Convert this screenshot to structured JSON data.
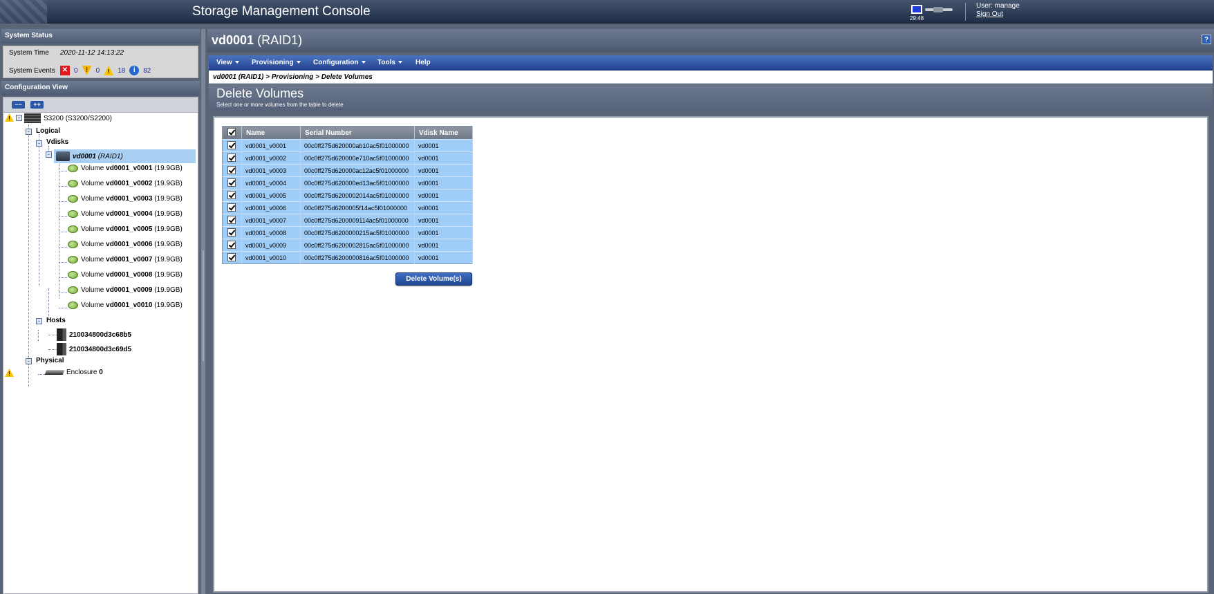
{
  "header": {
    "title": "Storage Management Console",
    "clock": "29:48",
    "user_label": "User: manage",
    "sign_out": "Sign Out"
  },
  "system_status": {
    "heading": "System Status",
    "time_label": "System Time",
    "time_value": "2020-11-12 14:13:22",
    "events_label": "System Events",
    "events": {
      "error": "0",
      "critical": "0",
      "warning": "18",
      "info": "82"
    }
  },
  "config_view": {
    "heading": "Configuration View",
    "collapse_label": "−−",
    "expand_label": "++",
    "array": "S3200 (S3200/S2200)",
    "logical": "Logical",
    "vdisks": "Vdisks",
    "vdisk_name": "vd0001",
    "vdisk_type": "(RAID1)",
    "volumes": [
      {
        "prefix": "Volume",
        "name": "vd0001_v0001",
        "size": "(19.9GB)"
      },
      {
        "prefix": "Volume",
        "name": "vd0001_v0002",
        "size": "(19.9GB)"
      },
      {
        "prefix": "Volume",
        "name": "vd0001_v0003",
        "size": "(19.9GB)"
      },
      {
        "prefix": "Volume",
        "name": "vd0001_v0004",
        "size": "(19.9GB)"
      },
      {
        "prefix": "Volume",
        "name": "vd0001_v0005",
        "size": "(19.9GB)"
      },
      {
        "prefix": "Volume",
        "name": "vd0001_v0006",
        "size": "(19.9GB)"
      },
      {
        "prefix": "Volume",
        "name": "vd0001_v0007",
        "size": "(19.9GB)"
      },
      {
        "prefix": "Volume",
        "name": "vd0001_v0008",
        "size": "(19.9GB)"
      },
      {
        "prefix": "Volume",
        "name": "vd0001_v0009",
        "size": "(19.9GB)"
      },
      {
        "prefix": "Volume",
        "name": "vd0001_v0010",
        "size": "(19.9GB)"
      }
    ],
    "hosts": "Hosts",
    "host_list": [
      "210034800d3c68b5",
      "210034800d3c69d5"
    ],
    "physical": "Physical",
    "enclosure_prefix": "Enclosure",
    "enclosure_num": "0"
  },
  "main": {
    "title_name": "vd0001",
    "title_type": "(RAID1)",
    "help": "?",
    "menu": [
      "View",
      "Provisioning",
      "Configuration",
      "Tools",
      "Help"
    ],
    "breadcrumb": "vd0001 (RAID1) > Provisioning > Delete Volumes",
    "section_title": "Delete Volumes",
    "section_subtitle": "Select one or more volumes from the table to delete",
    "table": {
      "headers": [
        "Name",
        "Serial Number",
        "Vdisk Name"
      ],
      "rows": [
        [
          "vd0001_v0001",
          "00c0ff275d620000ab10ac5f01000000",
          "vd0001"
        ],
        [
          "vd0001_v0002",
          "00c0ff275d620000e710ac5f01000000",
          "vd0001"
        ],
        [
          "vd0001_v0003",
          "00c0ff275d620000ac12ac5f01000000",
          "vd0001"
        ],
        [
          "vd0001_v0004",
          "00c0ff275d620000ed13ac5f01000000",
          "vd0001"
        ],
        [
          "vd0001_v0005",
          "00c0ff275d6200002014ac5f01000000",
          "vd0001"
        ],
        [
          "vd0001_v0006",
          "00c0ff275d6200005f14ac5f01000000",
          "vd0001"
        ],
        [
          "vd0001_v0007",
          "00c0ff275d6200009114ac5f01000000",
          "vd0001"
        ],
        [
          "vd0001_v0008",
          "00c0ff275d6200000215ac5f01000000",
          "vd0001"
        ],
        [
          "vd0001_v0009",
          "00c0ff275d6200002815ac5f01000000",
          "vd0001"
        ],
        [
          "vd0001_v0010",
          "00c0ff275d6200000816ac5f01000000",
          "vd0001"
        ]
      ]
    },
    "delete_button": "Delete Volume(s)"
  }
}
